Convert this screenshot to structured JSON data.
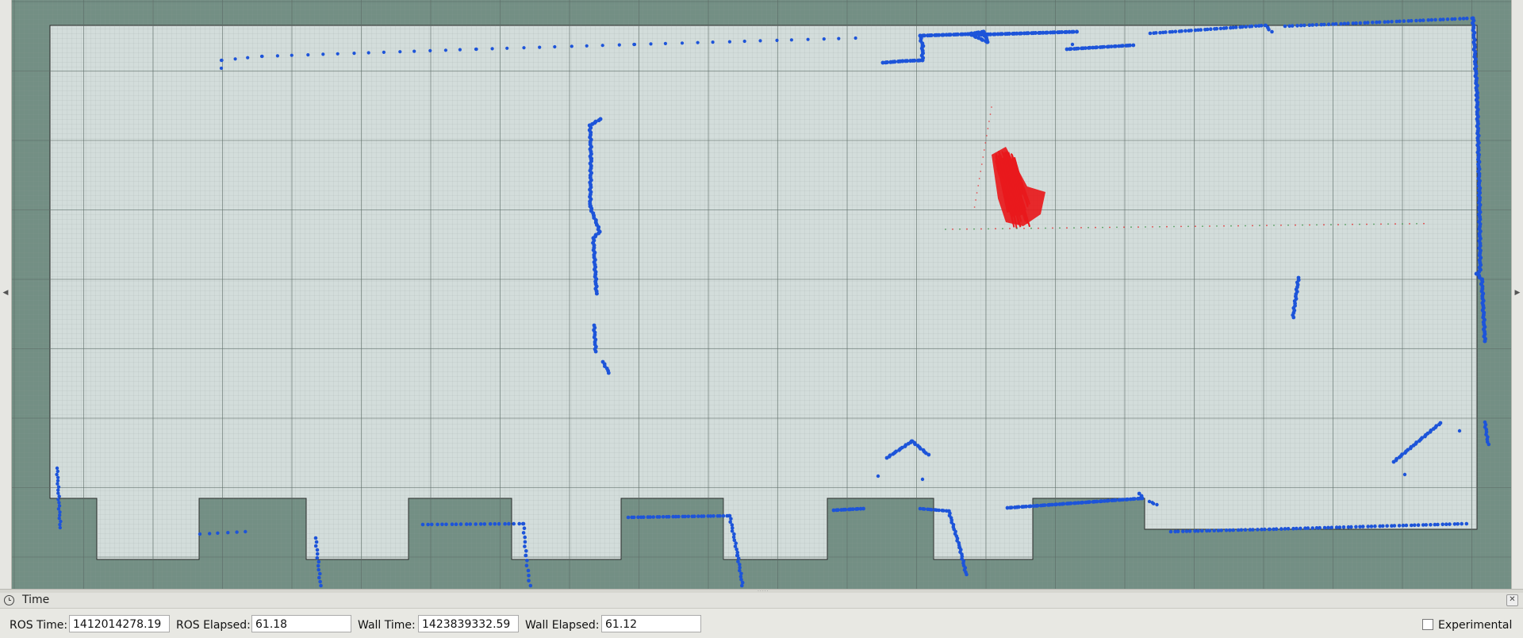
{
  "panel": {
    "title": "Time",
    "close_glyph": "✕",
    "icon": "clock-icon"
  },
  "fields": {
    "ros_time_label": "ROS Time:",
    "ros_time_value": "1412014278.19",
    "ros_elapsed_label": "ROS Elapsed:",
    "ros_elapsed_value": "61.18",
    "wall_time_label": "Wall Time:",
    "wall_time_value": "1423839332.59",
    "wall_elapsed_label": "Wall Elapsed:",
    "wall_elapsed_value": "61.12"
  },
  "experimental": {
    "label": "Experimental",
    "checked": false
  },
  "map": {
    "colors": {
      "unknown": "#738f84",
      "free": "#d3dddb",
      "grid": "#5c6b66",
      "laser": "#1d54d9",
      "particles": "#e8191c"
    }
  },
  "side_handles": {
    "left_glyph": "◀",
    "right_glyph": "▶"
  }
}
